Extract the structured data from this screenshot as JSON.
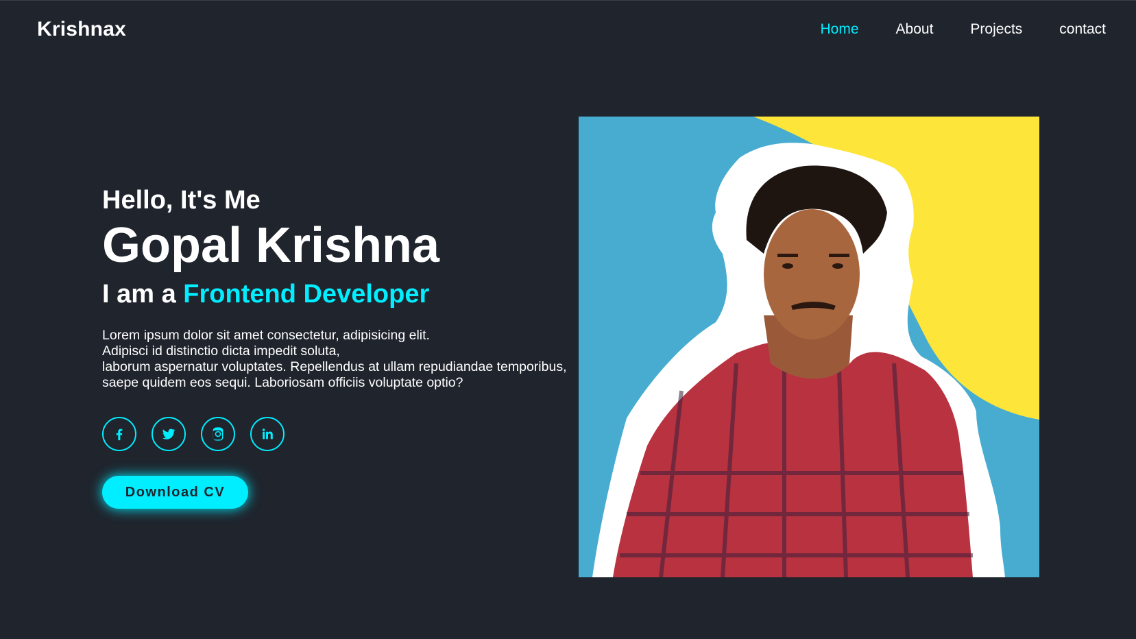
{
  "header": {
    "logo": "Krishnax",
    "nav": [
      {
        "label": "Home",
        "active": true
      },
      {
        "label": "About",
        "active": false
      },
      {
        "label": "Projects",
        "active": false
      },
      {
        "label": "contact",
        "active": false
      }
    ]
  },
  "hero": {
    "greeting": "Hello, It's Me",
    "name": "Gopal Krishna",
    "role_prefix": "I am a",
    "role_highlight": "Frontend Developer",
    "description": "Lorem ipsum dolor sit amet consectetur, adipisicing elit.\nAdipisci id distinctio dicta impedit soluta,\nlaborum aspernatur voluptates. Repellendus at ullam repudiandae temporibus,\nsaepe quidem eos sequi. Laboriosam officiis voluptate optio?",
    "socials": [
      {
        "icon": "facebook-icon"
      },
      {
        "icon": "twitter-icon"
      },
      {
        "icon": "instagram-icon"
      },
      {
        "icon": "linkedin-icon"
      }
    ],
    "cta_label": "Download CV"
  },
  "colors": {
    "background": "#1f242d",
    "accent": "#00eeff",
    "photo_blue": "#47acd0",
    "photo_yellow": "#fde53a",
    "shirt_red": "#b8323f"
  },
  "photo": {
    "icon": "profile-photo"
  }
}
